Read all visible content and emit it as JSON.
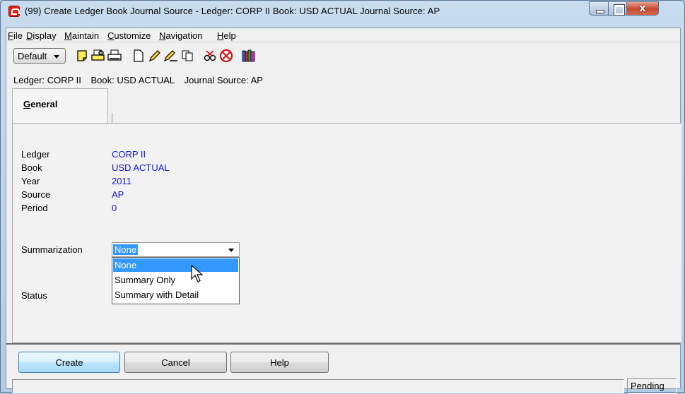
{
  "window": {
    "title": "(99) Create Ledger Book Journal Source - Ledger: CORP II    Book: USD ACTUAL    Journal Source: AP",
    "close_glyph": "x"
  },
  "menu": [
    {
      "label": "File",
      "key": "F",
      "rest": "ile"
    },
    {
      "label": "Display",
      "key": "D",
      "rest": "isplay"
    },
    {
      "label": "Maintain",
      "key": "M",
      "rest": "aintain"
    },
    {
      "label": "Customize",
      "key": "C",
      "rest": "ustomize"
    },
    {
      "label": "Navigation",
      "key": "N",
      "rest": "avigation"
    },
    {
      "label": "Help",
      "key": "H",
      "rest": "elp"
    }
  ],
  "toolbar": {
    "profile_selected": "Default",
    "icons": [
      "notes-icon",
      "print-preview-icon",
      "print-icon",
      "new-document-icon",
      "edit-pencil-icon",
      "edit-document-icon",
      "copy-icon",
      "scissors-icon",
      "delete-icon",
      "books-icon"
    ]
  },
  "info_line": {
    "ledger": "Ledger: CORP II",
    "book": "Book: USD ACTUAL",
    "journal_source": "Journal Source: AP"
  },
  "tab": {
    "key": "G",
    "rest": "eneral"
  },
  "fields": [
    {
      "label": "Ledger",
      "value": "CORP II"
    },
    {
      "label": "Book",
      "value": "USD ACTUAL"
    },
    {
      "label": "Year",
      "value": "2011"
    },
    {
      "label": "Source",
      "value": "AP"
    },
    {
      "label": "Period",
      "value": "0"
    }
  ],
  "summarization": {
    "label": "Summarization",
    "selected": "None",
    "options": [
      "None",
      "Summary Only",
      "Summary with Detail"
    ]
  },
  "status": {
    "label": "Status"
  },
  "buttons": {
    "create": "Create",
    "cancel": "Cancel",
    "help": "Help"
  },
  "statusbar": {
    "message": "",
    "state": "Pending"
  },
  "colors": {
    "value_text": "#1515d6",
    "selection": "#3399ff"
  }
}
